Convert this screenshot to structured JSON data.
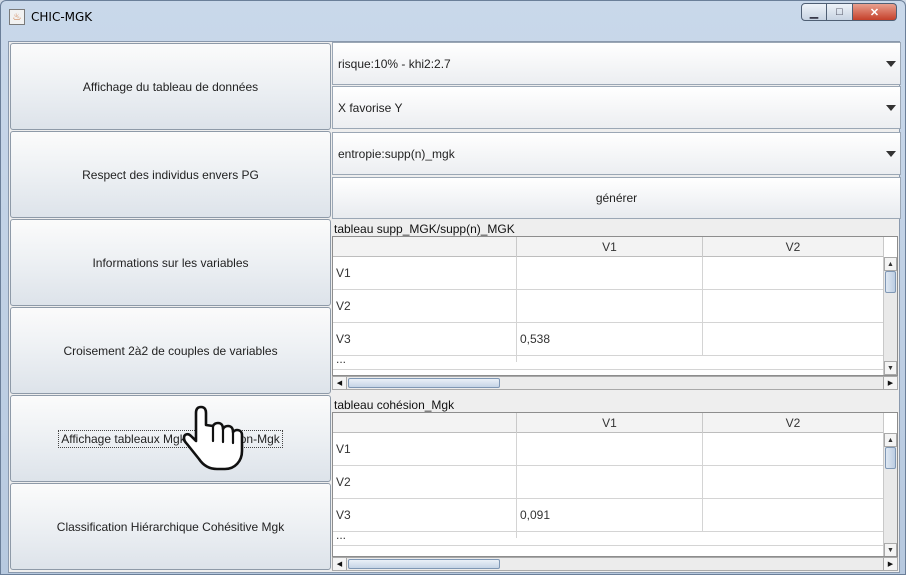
{
  "window": {
    "title": "CHIC-MGK"
  },
  "left_buttons": [
    {
      "label": "Affichage du tableau de données"
    },
    {
      "label": "Respect des individus envers PG"
    },
    {
      "label": "Informations sur les variables"
    },
    {
      "label": "Croisement 2à2 de couples de variables"
    },
    {
      "label": "Affichage tableaux Mgk et Cohésion-Mgk"
    },
    {
      "label": "Classification Hiérarchique Cohésitive Mgk"
    }
  ],
  "combos": [
    {
      "value": "risque:10% - khi2:2.7"
    },
    {
      "value": "X favorise Y"
    },
    {
      "value": "entropie:supp(n)_mgk"
    }
  ],
  "generate_label": "générer",
  "table1": {
    "title": "tableau supp_MGK/supp(n)_MGK",
    "columns": [
      "",
      "V1",
      "V2"
    ],
    "rows": [
      [
        "V1",
        "",
        ""
      ],
      [
        "V2",
        "",
        ""
      ],
      [
        "V3",
        "0,538",
        ""
      ],
      [
        "...",
        "",
        ""
      ]
    ]
  },
  "table2": {
    "title": "tableau cohésion_Mgk",
    "columns": [
      "",
      "V1",
      "V2"
    ],
    "rows": [
      [
        "V1",
        "",
        ""
      ],
      [
        "V2",
        "",
        ""
      ],
      [
        "V3",
        "0,091",
        ""
      ],
      [
        "...",
        "",
        ""
      ]
    ]
  },
  "icons": {
    "app": "java-cup-icon",
    "cursor": "hand-pointer-icon",
    "minimize": "minimize-icon",
    "maximize": "maximize-icon",
    "close": "close-icon"
  }
}
